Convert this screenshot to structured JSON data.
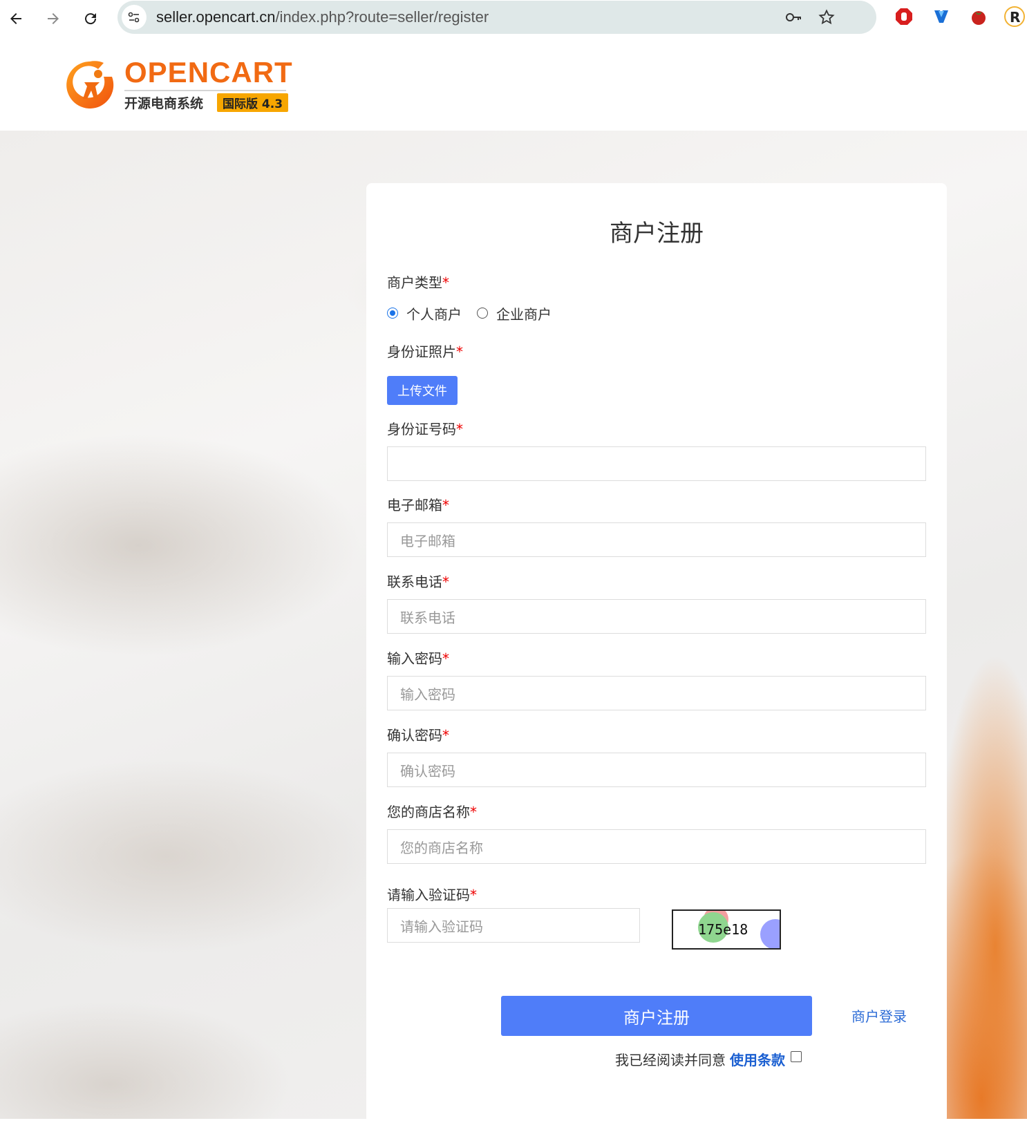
{
  "browser": {
    "url_host": "seller.opencart.cn",
    "url_path": "/index.php?route=seller/register"
  },
  "logo": {
    "brand": "OPENCART",
    "subtitle": "开源电商系统",
    "badge": "国际版 4.3"
  },
  "form": {
    "title": "商户注册",
    "merchant_type": {
      "label": "商户类型",
      "options": [
        "个人商户",
        "企业商户"
      ],
      "selected": "个人商户"
    },
    "id_photo": {
      "label": "身份证照片",
      "button": "上传文件"
    },
    "id_number": {
      "label": "身份证号码",
      "placeholder": ""
    },
    "email": {
      "label": "电子邮箱",
      "placeholder": "电子邮箱"
    },
    "phone": {
      "label": "联系电话",
      "placeholder": "联系电话"
    },
    "password": {
      "label": "输入密码",
      "placeholder": "输入密码"
    },
    "confirm_password": {
      "label": "确认密码",
      "placeholder": "确认密码"
    },
    "store_name": {
      "label": "您的商店名称",
      "placeholder": "您的商店名称"
    },
    "captcha": {
      "label": "请输入验证码",
      "placeholder": "请输入验证码",
      "code": "175e18"
    },
    "required_mark": "*",
    "submit": "商户注册",
    "login_link": "商户登录",
    "agree_text": "我已经阅读并同意",
    "terms_link": "使用条款",
    "agree_checked": false
  },
  "colors": {
    "primary": "#4f7df9",
    "brand_orange": "#f16a13",
    "required": "#ee0000",
    "link": "#2a6ad6"
  }
}
